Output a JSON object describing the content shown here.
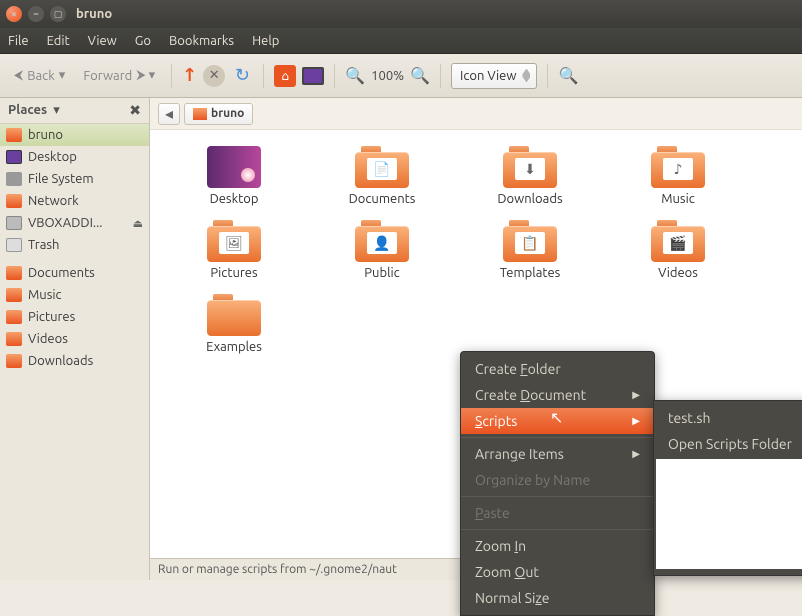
{
  "window": {
    "title": "bruno"
  },
  "menus": {
    "file": "File",
    "edit": "Edit",
    "view": "View",
    "go": "Go",
    "bookmarks": "Bookmarks",
    "help": "Help"
  },
  "toolbar": {
    "back": "Back",
    "forward": "Forward",
    "zoom_pct": "100%",
    "view_mode": "Icon View"
  },
  "sidebar": {
    "header": "Places",
    "items": [
      {
        "label": "bruno"
      },
      {
        "label": "Desktop"
      },
      {
        "label": "File System"
      },
      {
        "label": "Network"
      },
      {
        "label": "VBOXADDI..."
      },
      {
        "label": "Trash"
      },
      {
        "label": "Documents"
      },
      {
        "label": "Music"
      },
      {
        "label": "Pictures"
      },
      {
        "label": "Videos"
      },
      {
        "label": "Downloads"
      }
    ]
  },
  "path": {
    "crumb": "bruno"
  },
  "files": [
    {
      "label": "Desktop"
    },
    {
      "label": "Documents"
    },
    {
      "label": "Downloads"
    },
    {
      "label": "Music"
    },
    {
      "label": "Pictures"
    },
    {
      "label": "Public"
    },
    {
      "label": "Templates"
    },
    {
      "label": "Videos"
    },
    {
      "label": "Examples"
    }
  ],
  "context_menu": {
    "create_folder": "Create Folder",
    "create_document": "Create Document",
    "scripts": "Scripts",
    "arrange": "Arrange Items",
    "organize": "Organize by Name",
    "paste": "Paste",
    "zoom_in": "Zoom In",
    "zoom_out": "Zoom Out",
    "normal_size": "Normal Size"
  },
  "submenu": {
    "test": "test.sh",
    "open_folder": "Open Scripts Folder"
  },
  "status": "Run or manage scripts from ~/.gnome2/naut"
}
